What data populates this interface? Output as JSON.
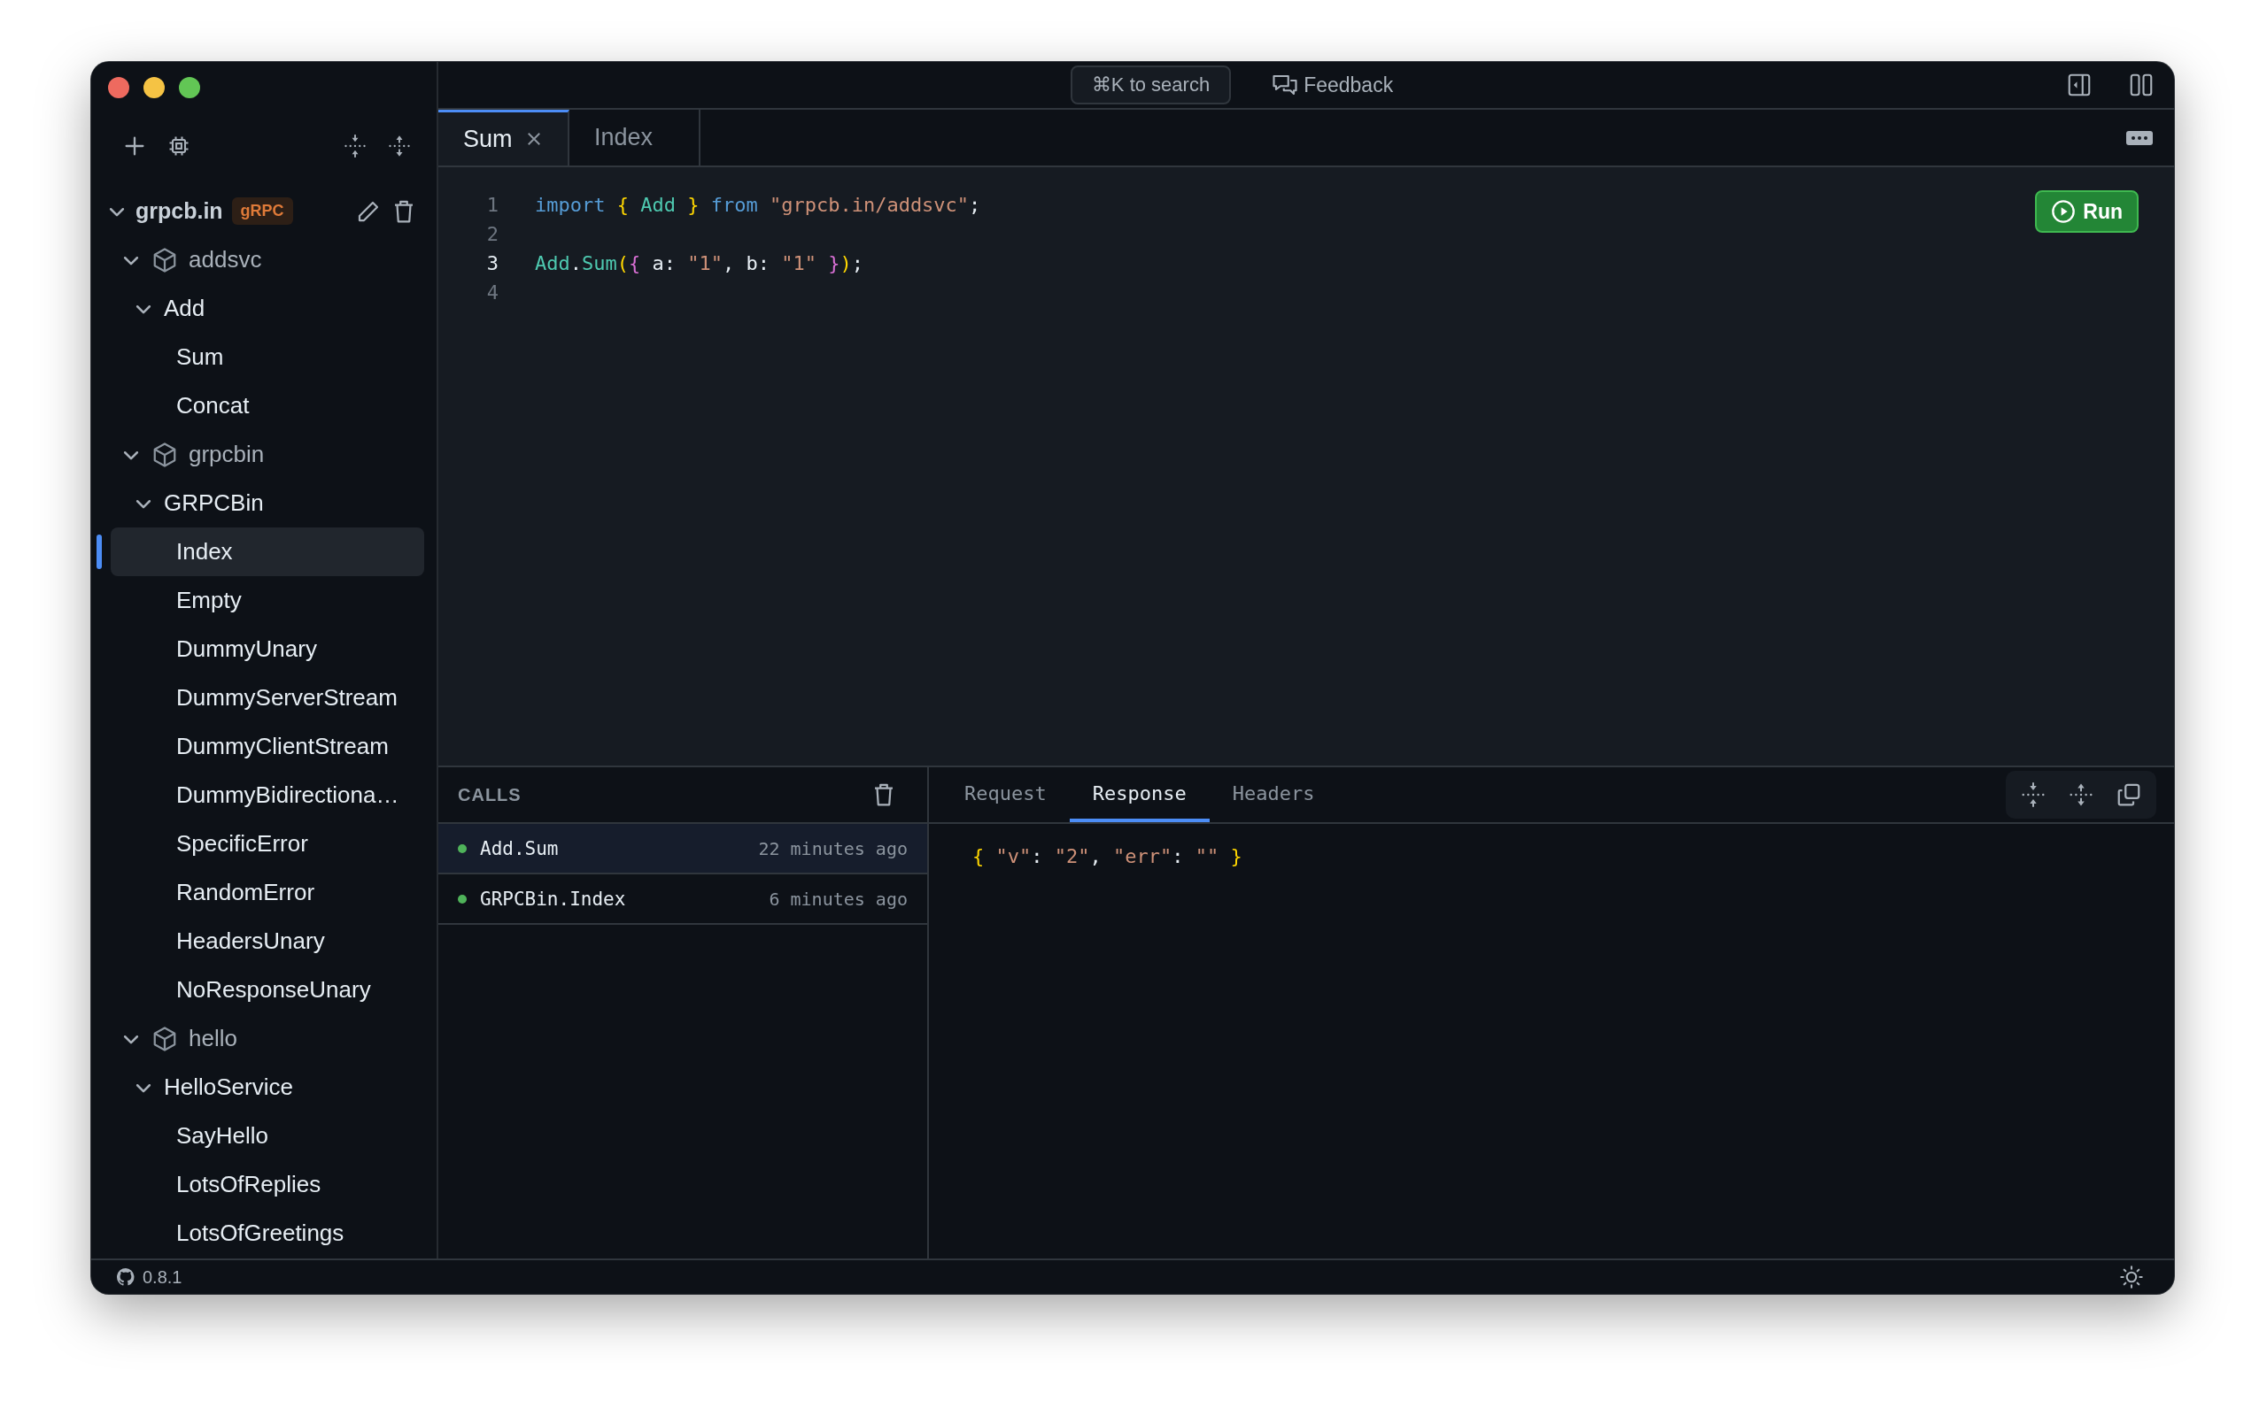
{
  "sidebar": {
    "tree": [
      {
        "kind": "host",
        "label": "grpcb.in",
        "badge": "gRPC",
        "expanded": true,
        "children": [
          {
            "kind": "package",
            "label": "addsvc",
            "expanded": true,
            "children": [
              {
                "kind": "service",
                "label": "Add",
                "expanded": true,
                "children": [
                  {
                    "kind": "method",
                    "label": "Sum",
                    "selected": false
                  },
                  {
                    "kind": "method",
                    "label": "Concat",
                    "selected": false
                  }
                ]
              }
            ]
          },
          {
            "kind": "package",
            "label": "grpcbin",
            "expanded": true,
            "children": [
              {
                "kind": "service",
                "label": "GRPCBin",
                "expanded": true,
                "children": [
                  {
                    "kind": "method",
                    "label": "Index",
                    "selected": true
                  },
                  {
                    "kind": "method",
                    "label": "Empty",
                    "selected": false
                  },
                  {
                    "kind": "method",
                    "label": "DummyUnary",
                    "selected": false
                  },
                  {
                    "kind": "method",
                    "label": "DummyServerStream",
                    "selected": false
                  },
                  {
                    "kind": "method",
                    "label": "DummyClientStream",
                    "selected": false
                  },
                  {
                    "kind": "method",
                    "label": "DummyBidirectiona…",
                    "selected": false
                  },
                  {
                    "kind": "method",
                    "label": "SpecificError",
                    "selected": false
                  },
                  {
                    "kind": "method",
                    "label": "RandomError",
                    "selected": false
                  },
                  {
                    "kind": "method",
                    "label": "HeadersUnary",
                    "selected": false
                  },
                  {
                    "kind": "method",
                    "label": "NoResponseUnary",
                    "selected": false
                  }
                ]
              }
            ]
          },
          {
            "kind": "package",
            "label": "hello",
            "expanded": true,
            "children": [
              {
                "kind": "service",
                "label": "HelloService",
                "expanded": true,
                "children": [
                  {
                    "kind": "method",
                    "label": "SayHello",
                    "selected": false
                  },
                  {
                    "kind": "method",
                    "label": "LotsOfReplies",
                    "selected": false
                  },
                  {
                    "kind": "method",
                    "label": "LotsOfGreetings",
                    "selected": false
                  }
                ]
              }
            ]
          }
        ]
      }
    ]
  },
  "title_bar": {
    "search": "⌘K to search",
    "feedback": "Feedback"
  },
  "tabs": [
    {
      "label": "Sum",
      "selected": true,
      "closable": true
    },
    {
      "label": "Index",
      "selected": false,
      "closable": false
    }
  ],
  "editor": {
    "run_button": "Run",
    "lines": [
      {
        "number": "1",
        "active": false,
        "tokens": [
          {
            "text": "import ",
            "kind": "keyword"
          },
          {
            "text": "{",
            "kind": "brace"
          },
          {
            "text": " Add ",
            "kind": "ident"
          },
          {
            "text": "}",
            "kind": "brace"
          },
          {
            "text": " from ",
            "kind": "keyword"
          },
          {
            "text": "\"grpcb.in/addsvc\"",
            "kind": "string"
          },
          {
            "text": ";",
            "kind": "plain"
          }
        ]
      },
      {
        "number": "2",
        "active": false
      },
      {
        "number": "3",
        "active": true,
        "tokens": [
          {
            "text": "Add",
            "kind": "ident"
          },
          {
            "text": ".",
            "kind": "plain"
          },
          {
            "text": "Sum",
            "kind": "ident"
          },
          {
            "text": "(",
            "kind": "brace"
          },
          {
            "text": "{",
            "kind": "brace2"
          },
          {
            "text": " a: ",
            "kind": "plain"
          },
          {
            "text": "\"1\"",
            "kind": "string"
          },
          {
            "text": ", b: ",
            "kind": "plain"
          },
          {
            "text": "\"1\"",
            "kind": "string"
          },
          {
            "text": " }",
            "kind": "brace2"
          },
          {
            "text": ")",
            "kind": "brace"
          },
          {
            "text": ";",
            "kind": "plain"
          }
        ]
      },
      {
        "number": "4",
        "active": false
      }
    ]
  },
  "calls": {
    "title": "CALLS",
    "items": [
      {
        "name": "Add.Sum",
        "time": "22 minutes ago",
        "selected": true
      },
      {
        "name": "GRPCBin.Index",
        "time": "6 minutes ago",
        "selected": false
      }
    ]
  },
  "detail_tabs": [
    {
      "label": "Request",
      "selected": false
    },
    {
      "label": "Response",
      "selected": true
    },
    {
      "label": "Headers",
      "selected": false
    }
  ],
  "response": {
    "tokens": [
      {
        "text": "{ ",
        "kind": "brace"
      },
      {
        "text": "\"v\"",
        "kind": "string"
      },
      {
        "text": ": ",
        "kind": "plain"
      },
      {
        "text": "\"2\"",
        "kind": "string"
      },
      {
        "text": ", ",
        "kind": "plain"
      },
      {
        "text": "\"err\"",
        "kind": "string"
      },
      {
        "text": ": ",
        "kind": "plain"
      },
      {
        "text": "\"\"",
        "kind": "string"
      },
      {
        "text": " }",
        "kind": "brace"
      }
    ]
  },
  "status_bar": {
    "version": "0.8.1"
  }
}
